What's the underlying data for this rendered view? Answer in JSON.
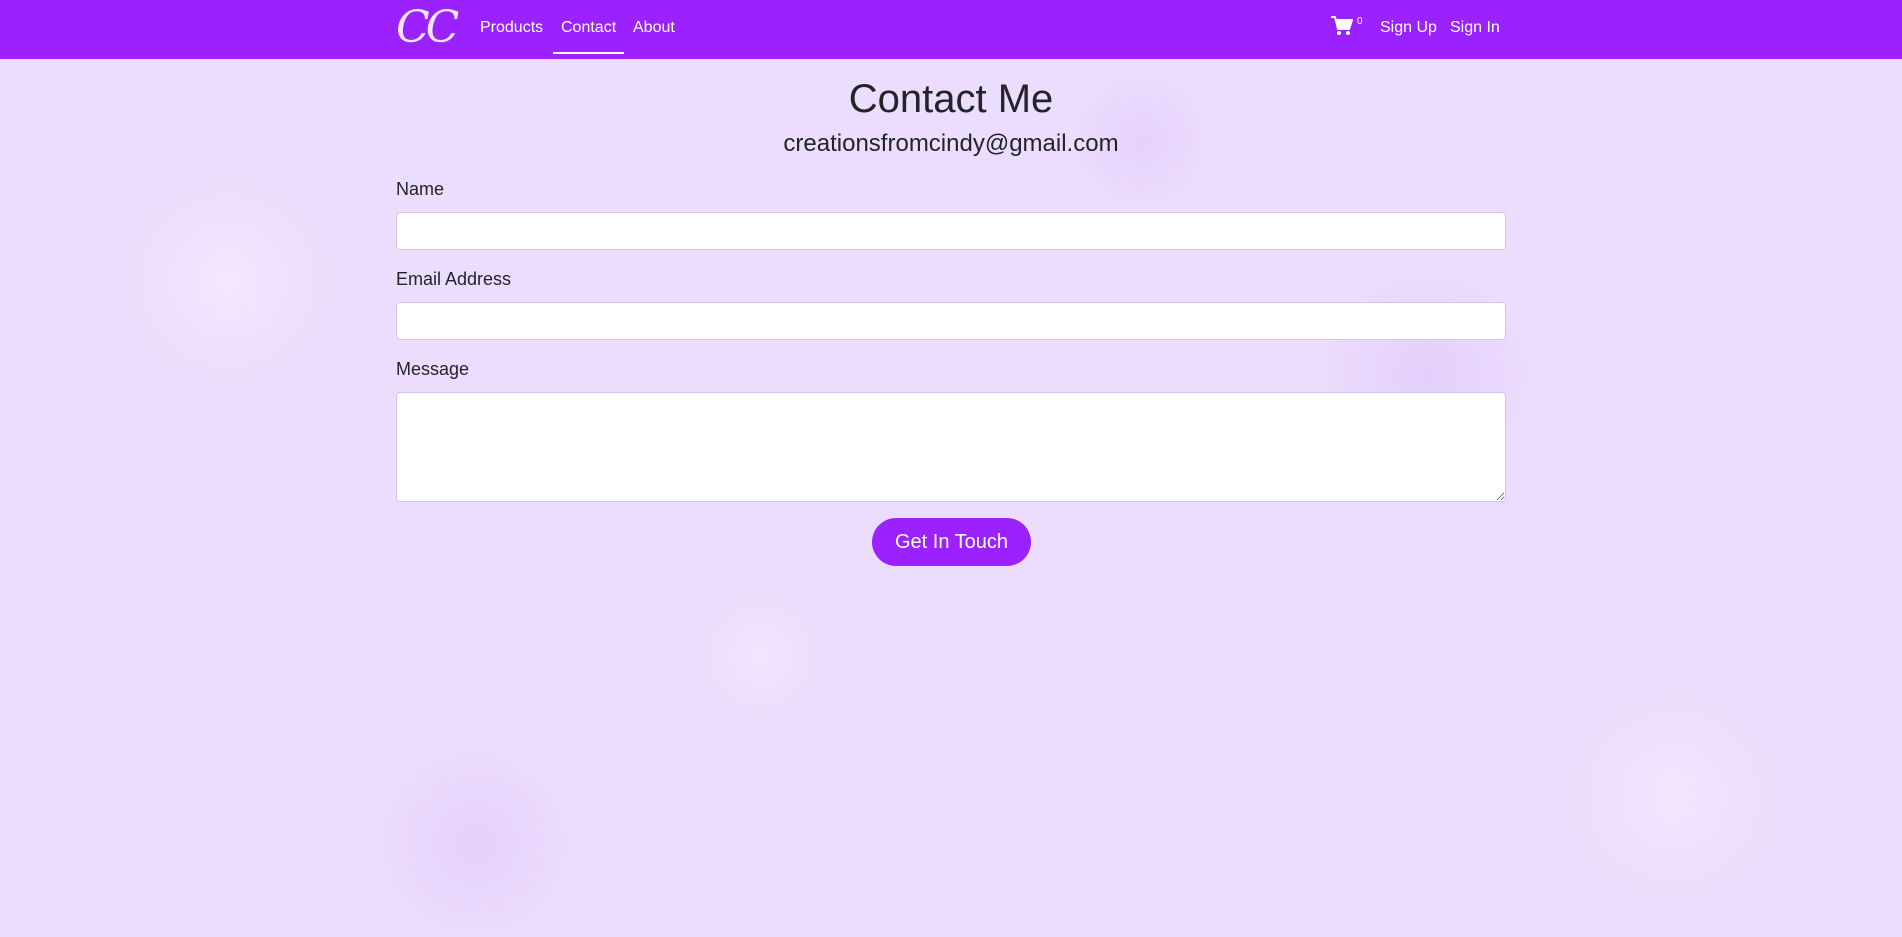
{
  "navbar": {
    "brand": "CC",
    "links": [
      {
        "label": "Products",
        "active": false
      },
      {
        "label": "Contact",
        "active": true
      },
      {
        "label": "About",
        "active": false
      }
    ],
    "cart": {
      "icon": "shopping-cart-icon",
      "count": "0"
    },
    "sign_up": "Sign Up",
    "sign_in": "Sign In",
    "color": "#9b21ff"
  },
  "page": {
    "title": "Contact Me",
    "email": "creationsfromcindy@gmail.com"
  },
  "form": {
    "name_label": "Name",
    "name_value": "",
    "email_label": "Email Address",
    "email_value": "",
    "message_label": "Message",
    "message_value": "",
    "submit_label": "Get In Touch"
  },
  "theme": {
    "accent": "#9b21ff",
    "background": "#ecdcfd"
  }
}
